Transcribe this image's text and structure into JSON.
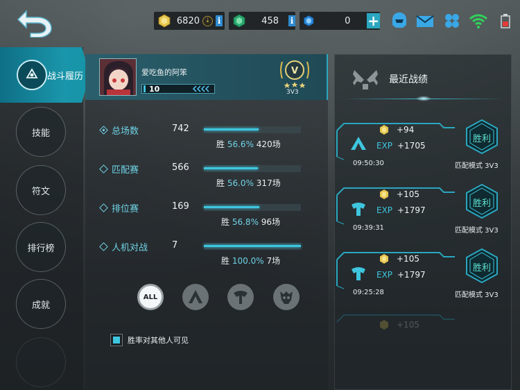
{
  "topbar": {
    "gold": "6820",
    "gems": "458",
    "diamonds": "0",
    "info_glyph": "i",
    "plus_glyph": "+",
    "icons": [
      "back-arrow-icon",
      "gold-coin-icon",
      "green-gem-icon",
      "blue-crystal-icon",
      "helmet-icon",
      "mail-icon",
      "clover-icon",
      "wifi-icon",
      "battery-icon"
    ]
  },
  "sidebar": {
    "active": "战斗履历",
    "items": [
      "技能",
      "符文",
      "排行榜",
      "成就"
    ]
  },
  "profile": {
    "name": "爱吃鱼的阿笨",
    "level": "10",
    "rank_letter": "V",
    "rank_mode": "3V3"
  },
  "stats": [
    {
      "label": "总场数",
      "total": "742",
      "win_prefix": "胜",
      "rate": "56.6%",
      "wins": "420场",
      "rate_value": 56.6
    },
    {
      "label": "匹配赛",
      "total": "566",
      "win_prefix": "胜",
      "rate": "56.0%",
      "wins": "317场",
      "rate_value": 56.0
    },
    {
      "label": "排位赛",
      "total": "169",
      "win_prefix": "胜",
      "rate": "56.8%",
      "wins": "96场",
      "rate_value": 56.8
    },
    {
      "label": "人机对战",
      "total": "7",
      "win_prefix": "胜",
      "rate": "100.0%",
      "wins": "7场",
      "rate_value": 100.0
    }
  ],
  "filters": {
    "all_label": "ALL",
    "icons": [
      "all-filter",
      "faction-a-filter-icon",
      "faction-b-filter-icon",
      "faction-c-filter-icon"
    ]
  },
  "visibility": {
    "label": "胜率对其他人可见",
    "checked": true
  },
  "recent": {
    "title": "最近战绩",
    "exp_label": "EXP",
    "matches": [
      {
        "coins": "+94",
        "exp": "+1705",
        "time": "09:50:30",
        "mode": "匹配模式 3V3",
        "result": "胜利",
        "hero_icon": "faction-a-icon"
      },
      {
        "coins": "+105",
        "exp": "+1797",
        "time": "09:39:31",
        "mode": "匹配模式 3V3",
        "result": "胜利",
        "hero_icon": "faction-b-icon"
      },
      {
        "coins": "+105",
        "exp": "+1797",
        "time": "09:25:28",
        "mode": "匹配模式 3V3",
        "result": "胜利",
        "hero_icon": "faction-b-icon"
      }
    ],
    "faded_coins": "+105"
  },
  "colors": {
    "accent": "#3ec6df",
    "active_tab": "#1a95aa",
    "gold": "#d2b450",
    "win": "#5fe0d0"
  }
}
